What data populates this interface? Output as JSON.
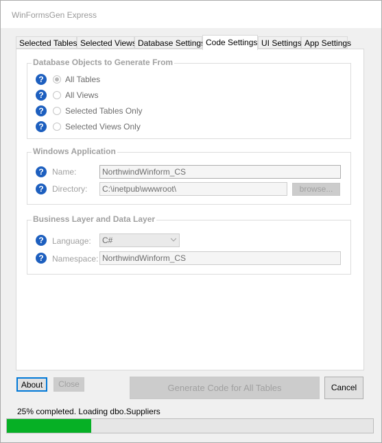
{
  "window": {
    "title": "WinFormsGen Express"
  },
  "tabs": [
    {
      "label": "Selected Tables",
      "active": false
    },
    {
      "label": "Selected Views",
      "active": false
    },
    {
      "label": "Database Settings",
      "active": false
    },
    {
      "label": "Code Settings",
      "active": true
    },
    {
      "label": "UI Settings",
      "active": false
    },
    {
      "label": "App Settings",
      "active": false
    }
  ],
  "db_objects": {
    "title": "Database Objects to Generate From",
    "options": [
      {
        "label": "All Tables",
        "selected": true
      },
      {
        "label": "All Views",
        "selected": false
      },
      {
        "label": "Selected Tables Only",
        "selected": false
      },
      {
        "label": "Selected Views Only",
        "selected": false
      }
    ]
  },
  "windows_app": {
    "title": "Windows Application",
    "name_label": "Name:",
    "name_value": "NorthwindWinform_CS",
    "directory_label": "Directory:",
    "directory_value": "C:\\inetpub\\wwwroot\\",
    "browse_label": "browse..."
  },
  "business_layer": {
    "title": "Business Layer and Data Layer",
    "language_label": "Language:",
    "language_value": "C#",
    "namespace_label": "Namespace:",
    "namespace_value": "NorthwindWinform_CS"
  },
  "buttons": {
    "about": "About",
    "close": "Close",
    "generate": "Generate Code for All Tables",
    "cancel": "Cancel"
  },
  "status": {
    "text": "25% completed.  Loading dbo.Suppliers",
    "progress_fraction": 0.23
  },
  "colors": {
    "help_icon": "#1d5fbf",
    "progress": "#06b025"
  }
}
